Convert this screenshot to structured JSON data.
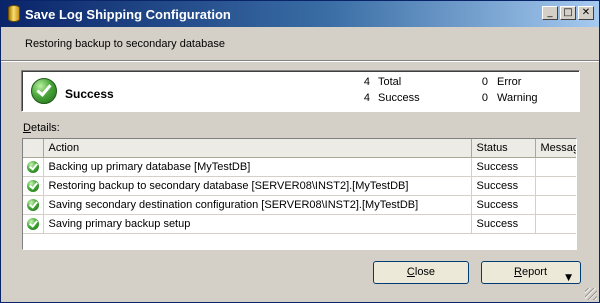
{
  "window": {
    "title": "Save Log Shipping Configuration",
    "minimize_glyph": "_",
    "maximize_glyph": "□",
    "close_glyph": "✕"
  },
  "subtitle": "Restoring backup to secondary database",
  "summary": {
    "status": "Success",
    "total_count": "4",
    "total_label": "Total",
    "success_count": "4",
    "success_label": "Success",
    "error_count": "0",
    "error_label": "Error",
    "warning_count": "0",
    "warning_label": "Warning"
  },
  "details": {
    "label_mnemonic": "D",
    "label_rest": "etails:",
    "columns": {
      "action": "Action",
      "status": "Status",
      "message": "Message"
    },
    "rows": [
      {
        "icon": "success-icon",
        "action": "Backing up primary database [MyTestDB]",
        "status": "Success",
        "message": ""
      },
      {
        "icon": "success-icon",
        "action": "Restoring backup to secondary database [SERVER08\\INST2].[MyTestDB]",
        "status": "Success",
        "message": ""
      },
      {
        "icon": "success-icon",
        "action": "Saving secondary destination configuration [SERVER08\\INST2].[MyTestDB]",
        "status": "Success",
        "message": ""
      },
      {
        "icon": "success-icon",
        "action": "Saving primary backup setup",
        "status": "Success",
        "message": ""
      }
    ]
  },
  "buttons": {
    "close_mnemonic": "C",
    "close_rest": "lose",
    "report_mnemonic": "R",
    "report_rest": "eport",
    "report_arrow": "▼"
  },
  "colors": {
    "titlebar_start": "#0a246a",
    "titlebar_end": "#a6caf0",
    "dialog_bg": "#d4d0c8",
    "success_green": "#3ea332"
  }
}
